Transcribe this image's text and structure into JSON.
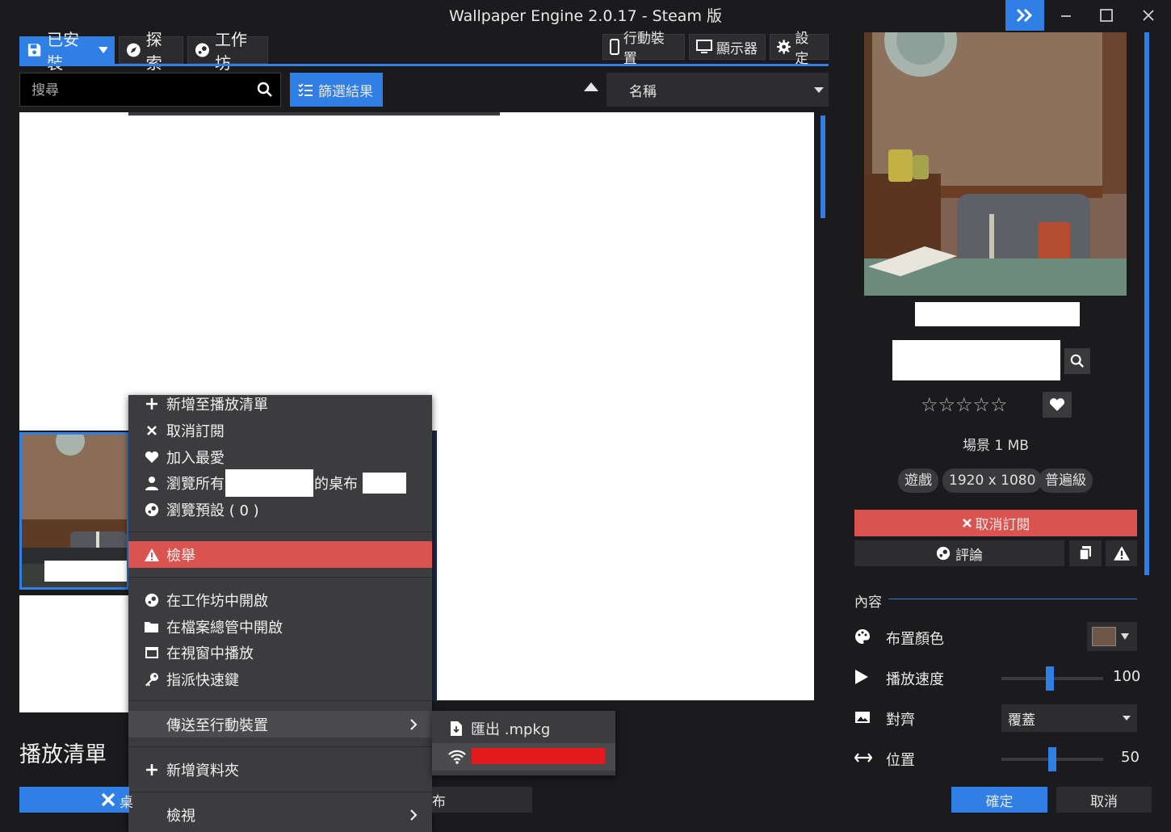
{
  "window": {
    "title": "Wallpaper Engine 2.0.17 - Steam 版"
  },
  "tabs": [
    {
      "label": "已安裝",
      "icon": "save-icon"
    },
    {
      "label": "探索",
      "icon": "compass-icon"
    },
    {
      "label": "工作坊",
      "icon": "steam-icon"
    }
  ],
  "toolbar": {
    "mobile": "行動裝置",
    "display": "顯示器",
    "settings": "設定"
  },
  "search": {
    "placeholder": "搜尋"
  },
  "filter": {
    "label": "篩選結果"
  },
  "sort": {
    "selected": "名稱"
  },
  "context_menu": {
    "items": [
      {
        "label": "新增至播放清單",
        "icon": "plus-icon"
      },
      {
        "label": "取消訂閱",
        "icon": "x-icon"
      },
      {
        "label": "加入最愛",
        "icon": "heart-icon"
      },
      {
        "label_prefix": "瀏覽所有",
        "label_suffix": "的桌布",
        "icon": "user-icon"
      },
      {
        "label": "瀏覽預設 ( 0 )",
        "icon": "steam-icon"
      },
      {
        "label": "檢舉",
        "icon": "warning-icon"
      },
      {
        "label": "在工作坊中開啟",
        "icon": "steam-icon"
      },
      {
        "label": "在檔案總管中開啟",
        "icon": "folder-icon"
      },
      {
        "label": "在視窗中播放",
        "icon": "window-icon"
      },
      {
        "label": "指派快速鍵",
        "icon": "key-icon"
      },
      {
        "label": "傳送至行動裝置",
        "icon": ""
      },
      {
        "label": "新增資料夾",
        "icon": "plus-icon"
      },
      {
        "label": "檢視",
        "icon": ""
      }
    ]
  },
  "submenu": {
    "export": "匯出 .mpkg"
  },
  "playlist": {
    "title": "播放清單",
    "btn1_visible": "桌",
    "btn2_visible": "布"
  },
  "details": {
    "type_size": "場景 1 MB",
    "tags": [
      "遊戲",
      "1920 x 1080",
      "普遍級"
    ],
    "unsubscribe": "取消訂閱",
    "comment": "評論",
    "rating": "☆☆☆☆☆"
  },
  "properties": {
    "section": "內容",
    "scheme_color": {
      "label": "布置顏色",
      "color": "#6e5649"
    },
    "speed": {
      "label": "播放速度",
      "value": "100",
      "fraction": 0.48
    },
    "alignment": {
      "label": "對齊",
      "selected": "覆蓋"
    },
    "position": {
      "label": "位置",
      "value": "50",
      "fraction": 0.5
    }
  },
  "footer": {
    "ok": "確定",
    "cancel": "取消"
  },
  "colors": {
    "accent": "#2f7fe4",
    "danger": "#d9534f",
    "redaction": "#e31a1c"
  }
}
